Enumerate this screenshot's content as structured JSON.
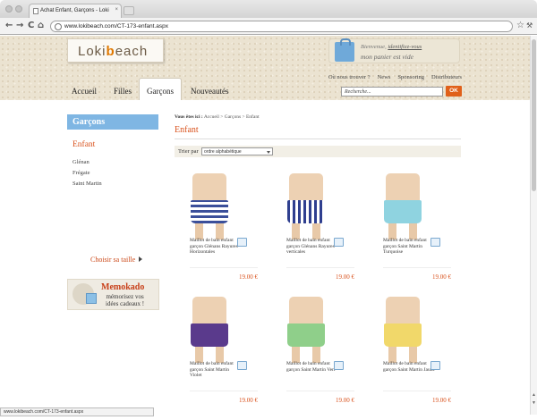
{
  "browser": {
    "tab_title": "Achat Enfant, Garçons - Loki",
    "tab_close": "×",
    "url": "www.lokibeach.com/CT-173-enfant.aspx",
    "back": "←",
    "forward": "→",
    "reload": "C",
    "home": "⌂",
    "star": "☆",
    "menu": "⚒",
    "status_url": "www.lokibeach.com/CT-173-enfant.aspx"
  },
  "header": {
    "logo_a": "Loki",
    "logo_b": "b",
    "logo_c": "each",
    "cart_welcome": "Bienvenue, ",
    "cart_login": "identifiez-vous",
    "cart_status": "mon panier est vide",
    "links": [
      "Où nous trouver ?",
      "News",
      "Sponsoring",
      "Distributeurs"
    ],
    "nav": [
      "Accueil",
      "Filles",
      "Garçons",
      "Nouveautés"
    ],
    "search_placeholder": "Recherche...",
    "search_button": "OK"
  },
  "sidebar": {
    "title": "Garçons",
    "subtitle": "Enfant",
    "links": [
      "Glénan",
      "Frégate",
      "Saint Martin"
    ],
    "size_link": "Choisir sa taille",
    "memo_title": "Memokado",
    "memo_line1": "mémorisez vos",
    "memo_line2": "idées cadeaux !"
  },
  "main": {
    "crumb_prefix": "Vous êtes ici :",
    "crumb_path": "Accueil > Garçons > Enfant",
    "title": "Enfant",
    "sort_label": "Trier par",
    "sort_value": "ordre alphabétique",
    "products": [
      {
        "name": "Maillot de bain enfant garçon Glénans Rayures Horizontales",
        "price": "19.00 €",
        "color": "#3b4f9a"
      },
      {
        "name": "Maillot de bain enfant garçon Glénans Rayures verticales",
        "price": "19.00 €",
        "color": "#2f3f8f"
      },
      {
        "name": "Maillot de bain enfant garçon Saint Martin Turquoise",
        "price": "19.00 €",
        "color": "#8fd3e0"
      },
      {
        "name": "Maillot de bain enfant garçon Saint Martin Violet",
        "price": "19.00 €",
        "color": "#5a3a8c"
      },
      {
        "name": "Maillot de bain enfant garçon Saint Martin Vert",
        "price": "19.00 €",
        "color": "#8fcf8a"
      },
      {
        "name": "Maillot de bain enfant garçon Saint Martin Jaune",
        "price": "19.00 €",
        "color": "#f1d86a"
      }
    ]
  }
}
